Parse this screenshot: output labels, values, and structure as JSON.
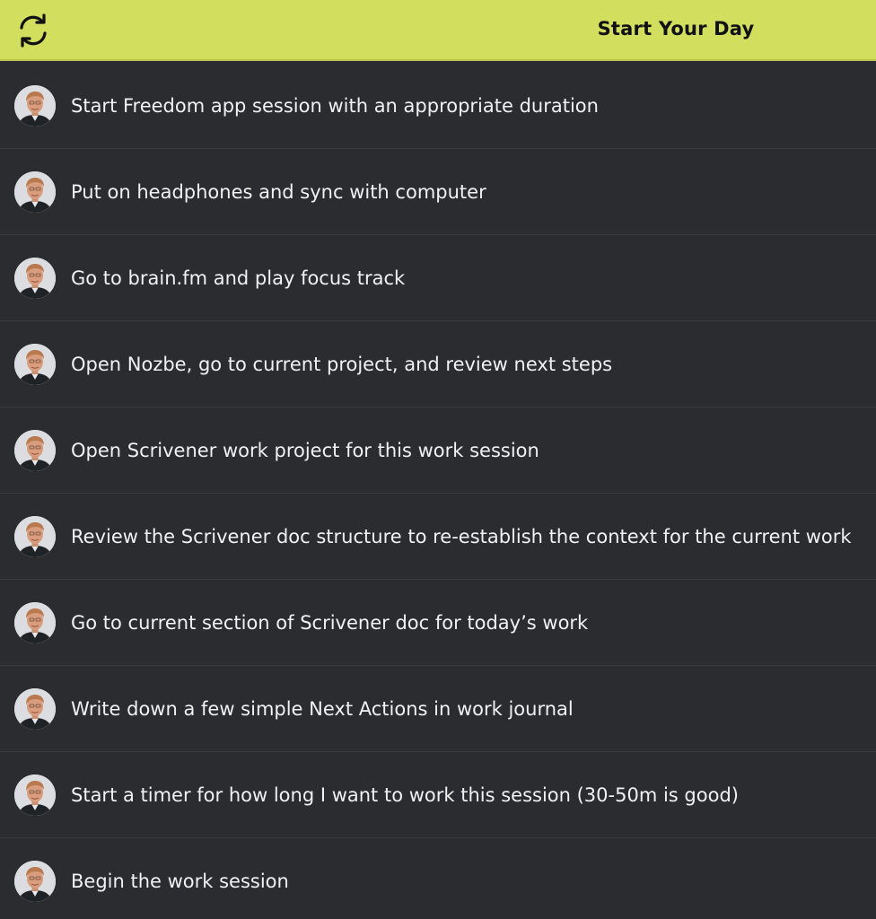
{
  "header": {
    "title": "Start Your Day",
    "refresh_icon": "refresh-icon",
    "accent_color": "#d1de5e"
  },
  "checklist": {
    "avatar_icon": "user-avatar",
    "items": [
      {
        "label": "Start Freedom app session with an appropriate duration"
      },
      {
        "label": "Put on headphones and sync with computer"
      },
      {
        "label": "Go to brain.fm and play focus track"
      },
      {
        "label": "Open Nozbe, go to current project, and review next steps"
      },
      {
        "label": "Open Scrivener work project for this work session"
      },
      {
        "label": "Review the Scrivener doc structure to re-establish the context for the current work"
      },
      {
        "label": "Go to current section of Scrivener doc for today’s work"
      },
      {
        "label": "Write down a few simple Next Actions in work journal"
      },
      {
        "label": "Start a timer for how long I want to work this session (30-50m is good)"
      },
      {
        "label": "Begin the work session"
      }
    ]
  }
}
